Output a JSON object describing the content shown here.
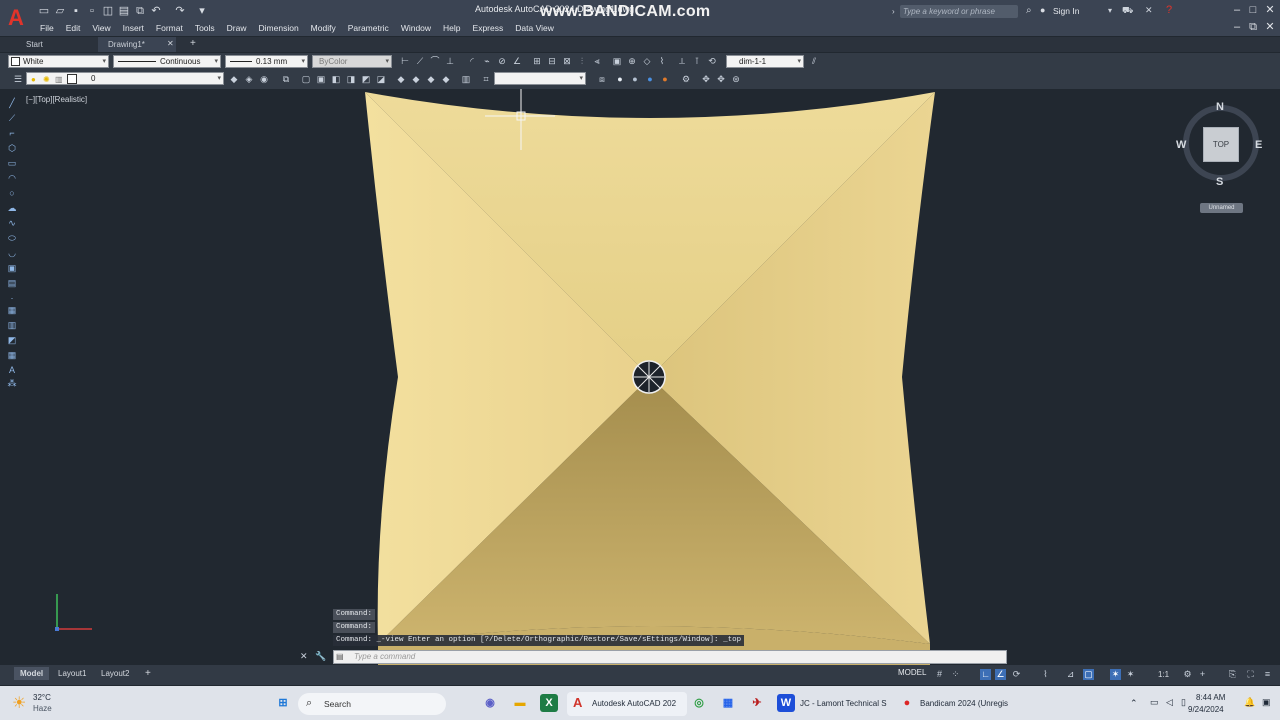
{
  "app": {
    "title": "Autodesk AutoCAD 2024  Drawing1.dwg",
    "watermark": "www.BANDICAM.com",
    "search_placeholder": "Type a keyword or phrase",
    "sign_in": "Sign In",
    "logo_letter": "A"
  },
  "menu": [
    "File",
    "Edit",
    "View",
    "Insert",
    "Format",
    "Tools",
    "Draw",
    "Dimension",
    "Modify",
    "Parametric",
    "Window",
    "Help",
    "Express",
    "Data View"
  ],
  "tabs": {
    "start": "Start",
    "drawing": "Drawing1*",
    "add": "+"
  },
  "properties": {
    "color": "White",
    "linetype": "Continuous",
    "lineweight": "0.13 mm",
    "plotstyle": "ByColor",
    "dimstyle": "dim-1-1",
    "layer": "0"
  },
  "viewport": {
    "label": "[−][Top][Realistic]"
  },
  "viewcube": {
    "face": "TOP",
    "north": "N",
    "south": "S",
    "east": "E",
    "west": "W",
    "ucs": "Unnamed"
  },
  "command": {
    "history": [
      "Command:",
      "Command:",
      "Command:  _-view Enter an option [?/Delete/Orthographic/Restore/Save/sEttings/Window]: _top"
    ],
    "input_placeholder": "Type a command"
  },
  "layout_tabs": [
    "Model",
    "Layout1",
    "Layout2"
  ],
  "status": {
    "model": "MODEL",
    "scale": "1:1"
  },
  "taskbar": {
    "weather_temp": "32°C",
    "weather_desc": "Haze",
    "search": "Search",
    "apps": [
      "Autodesk AutoCAD 202",
      "JC - Lamont Technical S",
      "Bandicam 2024 (Unregis"
    ],
    "time": "8:44 AM",
    "date": "9/24/2024"
  },
  "colors": {
    "canvas": "#212830",
    "shape": "#e9d591",
    "accent": "#e0342b"
  }
}
